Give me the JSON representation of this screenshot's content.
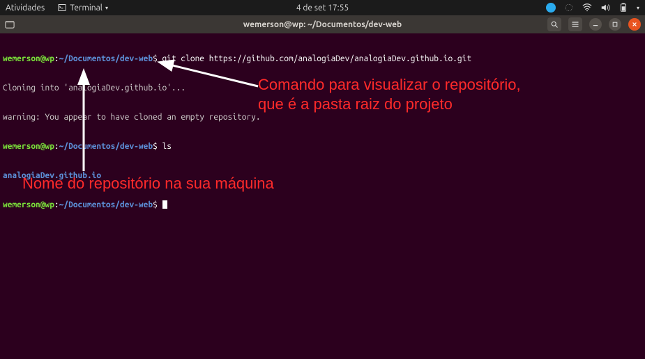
{
  "topbar": {
    "activities": "Atividades",
    "app_menu": "Terminal",
    "clock": "4 de set  17:55"
  },
  "titlebar": {
    "title": "wemerson@wp: ~/Documentos/dev-web"
  },
  "terminal": {
    "prompt_user": "wemerson@wp",
    "prompt_sep1": ":",
    "prompt_path": "~/Documentos/dev-web",
    "prompt_end": "$",
    "line1_cmd": "git clone https://github.com/analogiaDev/analogiaDev.github.io.git",
    "line2": "Cloning into 'analogiaDev.github.io'...",
    "line3": "warning: You appear to have cloned an empty repository.",
    "line4_cmd": "ls",
    "line5_dir": "analogiaDev.github.io",
    "line6_cmd": ""
  },
  "annotations": {
    "text1_line1": "Comando para visualizar o repositório,",
    "text1_line2": "que é a pasta raiz do projeto",
    "text2": "Nome do repositório na sua máquina"
  }
}
